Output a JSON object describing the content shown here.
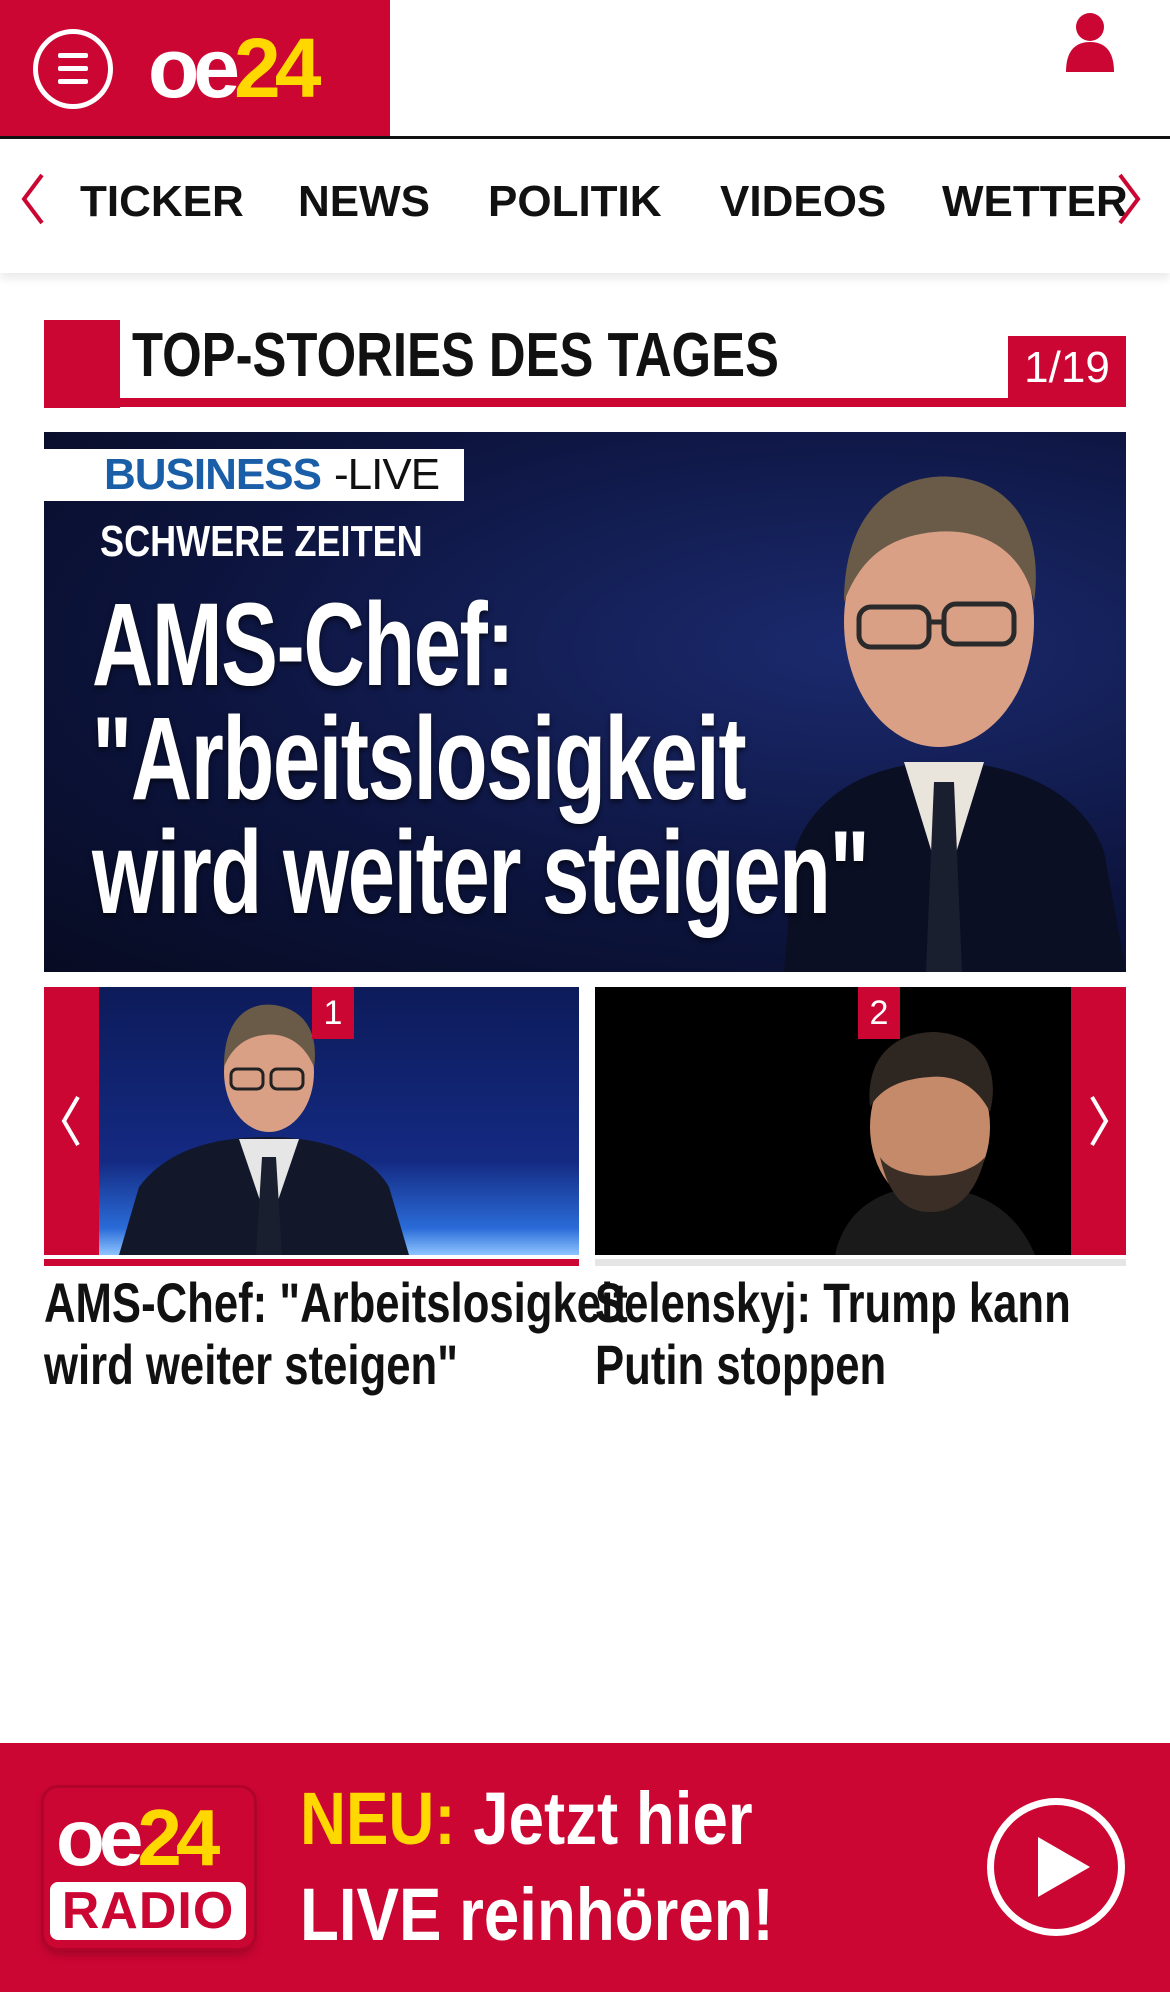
{
  "header": {
    "logo_oe": "oe",
    "logo_24": "24",
    "brand_color": "#cc0633",
    "accent_color": "#ffd800",
    "menu_icon": "hamburger-menu-icon",
    "user_icon": "user-icon"
  },
  "nav": {
    "items": [
      "TICKER",
      "NEWS",
      "POLITIK",
      "VIDEOS",
      "WETTER"
    ]
  },
  "section": {
    "title": "TOP-STORIES DES TAGES",
    "counter": "1/19"
  },
  "hero": {
    "tag_business": "BUSINESS",
    "tag_live": "-LIVE",
    "kicker": "SCHWERE ZEITEN",
    "headline_line1": "AMS-Chef:",
    "headline_line2": "\"Arbeitslosigkeit",
    "headline_line3": "wird weiter steigen\""
  },
  "carousel": {
    "cards": [
      {
        "number": "1",
        "caption_line1": "AMS-Chef: \"Arbeitslosigkeit",
        "caption_line2": "wird weiter steigen\""
      },
      {
        "number": "2",
        "caption_line1": "Selenskyj: Trump kann",
        "caption_line2": "Putin stoppen"
      }
    ]
  },
  "radio": {
    "logo_oe": "oe",
    "logo_24": "24",
    "logo_radio": "RADIO",
    "neu": "NEU:",
    "line1_rest": " Jetzt hier",
    "line2": "LIVE reinhören!"
  }
}
